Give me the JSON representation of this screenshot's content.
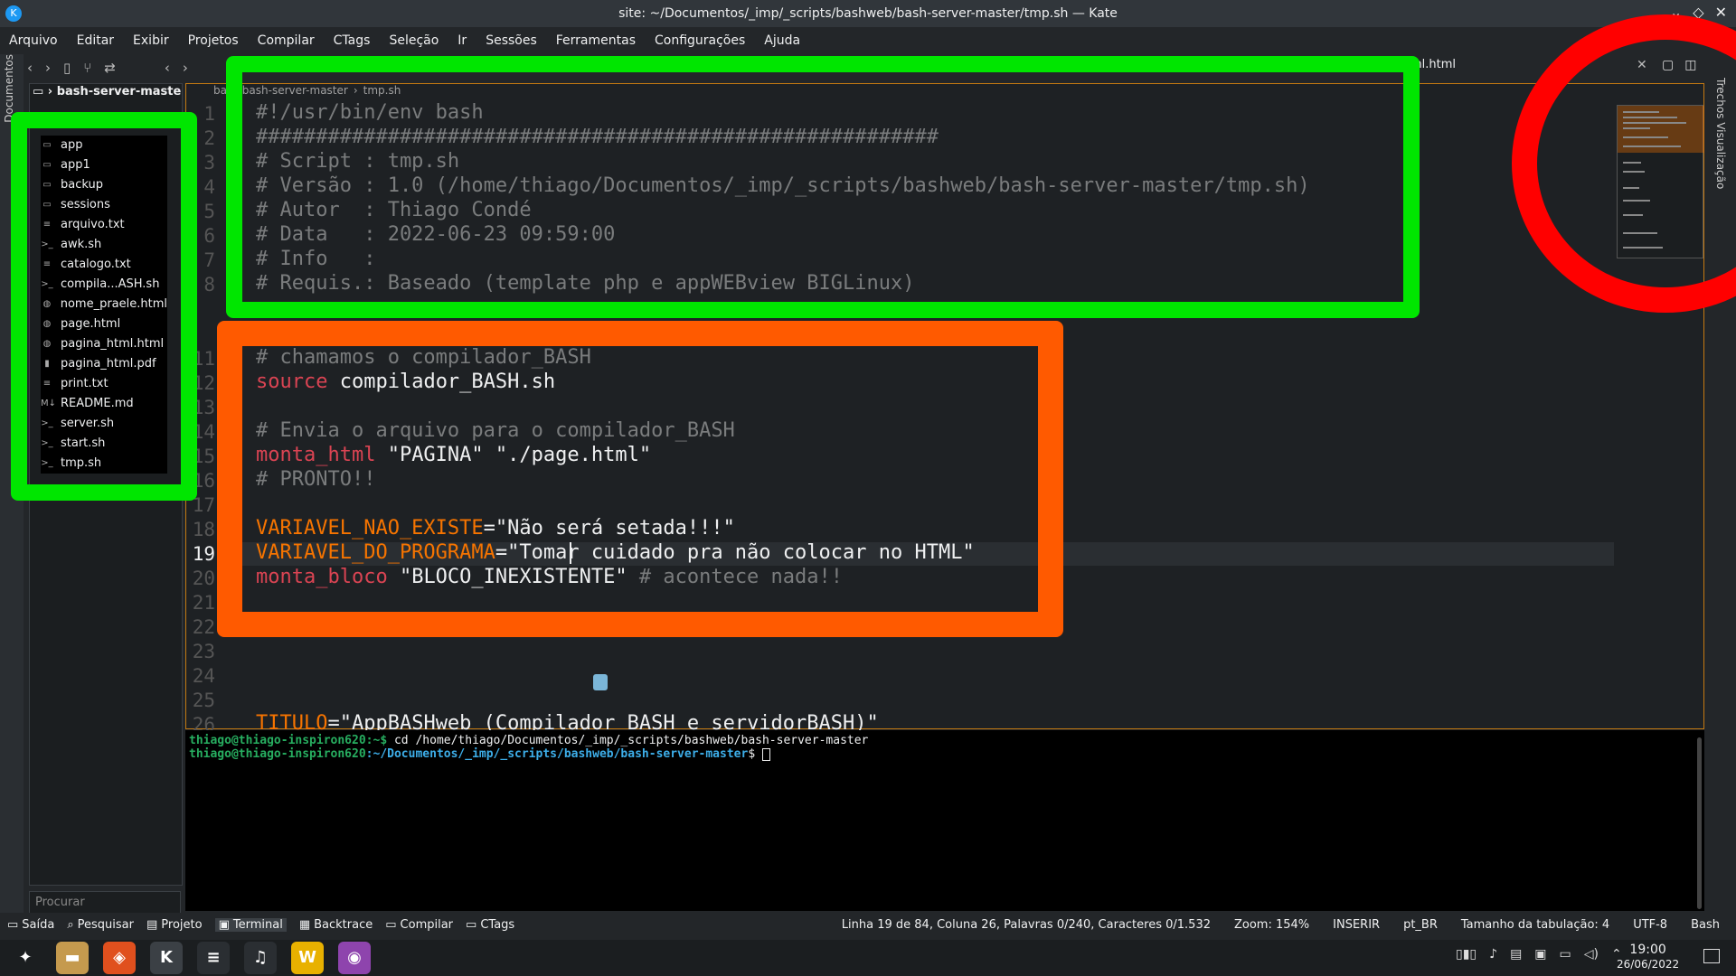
{
  "window": {
    "title": "site: ~/Documentos/_imp/_scripts/bashweb/bash-server-master/tmp.sh — Kate",
    "btn_min": "⌄",
    "btn_max": "◇",
    "btn_close": "✕"
  },
  "menubar": [
    "Arquivo",
    "Editar",
    "Exibir",
    "Projetos",
    "Compilar",
    "CTags",
    "Seleção",
    "Ir",
    "Sessões",
    "Ferramentas",
    "Configurações",
    "Ajuda"
  ],
  "left_strip_label": "Documentos",
  "right_strip_label": "Trechos  Visualização",
  "project": {
    "name": "bash-server-maste",
    "files": [
      {
        "name": "app",
        "icon": "folder-icon"
      },
      {
        "name": "app1",
        "icon": "folder-icon"
      },
      {
        "name": "backup",
        "icon": "folder-icon"
      },
      {
        "name": "sessions",
        "icon": "folder-icon"
      },
      {
        "name": "arquivo.txt",
        "icon": "text-file-icon"
      },
      {
        "name": "awk.sh",
        "icon": "script-icon"
      },
      {
        "name": "catalogo.txt",
        "icon": "text-file-icon"
      },
      {
        "name": "compila...ASH.sh",
        "icon": "script-icon"
      },
      {
        "name": "nome_praele.html",
        "icon": "html-icon"
      },
      {
        "name": "page.html",
        "icon": "html-icon"
      },
      {
        "name": "pagina_html.html",
        "icon": "html-icon"
      },
      {
        "name": "pagina_html.pdf",
        "icon": "pdf-icon"
      },
      {
        "name": "print.txt",
        "icon": "text-file-icon"
      },
      {
        "name": "README.md",
        "icon": "markdown-icon"
      },
      {
        "name": "server.sh",
        "icon": "script-icon"
      },
      {
        "name": "start.sh",
        "icon": "script-icon"
      },
      {
        "name": "tmp.sh",
        "icon": "script-icon"
      }
    ],
    "search_placeholder": "Procurar"
  },
  "editor": {
    "tab_partial": "ml.html",
    "breadcrumb": [
      "ba",
      "bash-server-master",
      "tmp.sh"
    ],
    "line_numbers": [
      "1",
      "2",
      "3",
      "4",
      "5",
      "6",
      "7",
      "8",
      "11",
      "12",
      "13",
      "14",
      "15",
      "16",
      "17",
      "18",
      "19",
      "20",
      "21",
      "22",
      "23",
      "24",
      "25",
      "26"
    ],
    "current_line": "19"
  },
  "code": {
    "l1": "#!/usr/bin/env bash",
    "l2": "#########################################################",
    "l3": "# Script : tmp.sh",
    "l4": "# Versão : 1.0 (/home/thiago/Documentos/_imp/_scripts/bashweb/bash-server-master/tmp.sh)",
    "l5": "# Autor  : Thiago Condé",
    "l6": "# Data   : 2022-06-23 09:59:00",
    "l7": "# Info   :",
    "l8": "# Requis.: Baseado (template php e appWEBview BIGLinux)",
    "l11": "# chamamos o compilador_BASH",
    "l12_kw": "source",
    "l12_rest": " compilador_BASH.sh",
    "l14": "# Envia o arquivo para o compilador_BASH",
    "l15_fn": "monta_html",
    "l15_rest": " \"PAGINA\" \"./page.html\"",
    "l16": "# PRONTO!!",
    "l18_var": "VARIAVEL_NAO_EXISTE",
    "l18_rest": "=\"Não será setada!!!\"",
    "l19_var": "VARIAVEL_DO_PROGRAMA",
    "l19_rest": "=\"Tomar cuidado pra não colocar no HTML\"",
    "l20_fn": "monta_bloco",
    "l20_str": " \"BLOCO_INEXISTENTE\"",
    "l20_cmt": " # acontece nada!!",
    "l26_var": "TITULO",
    "l26_rest": "=\"AppBASHweb (Compilador BASH e servidorBASH)\""
  },
  "terminal": {
    "user": "thiago@thiago-inspiron620",
    "line1_sep": ":~$",
    "line1_cmd": " cd /home/thiago/Documentos/_imp/_scripts/bashweb/bash-server-master",
    "line2_path": ":~/Documentos/_imp/_scripts/bashweb/bash-server-master",
    "line2_prompt": "$ "
  },
  "bottom_tabs": [
    "Saída",
    "Pesquisar",
    "Projeto",
    "Terminal",
    "Backtrace",
    "Compilar",
    "CTags"
  ],
  "status": {
    "position": "Linha 19 de 84, Coluna 26, Palavras 0/240, Caracteres 0/1.532",
    "zoom": "Zoom: 154%",
    "mode": "INSERIR",
    "lang": "pt_BR",
    "tab_size": "Tamanho da tabulação: 4",
    "encoding": "UTF-8",
    "syntax": "Bash"
  },
  "clock": {
    "time": "19:00",
    "date": "26/06/2022"
  },
  "colors": {
    "accent": "#f67400",
    "annotation_green": "#00e600",
    "annotation_orange": "#ff5a00",
    "annotation_red": "#ff0000"
  }
}
